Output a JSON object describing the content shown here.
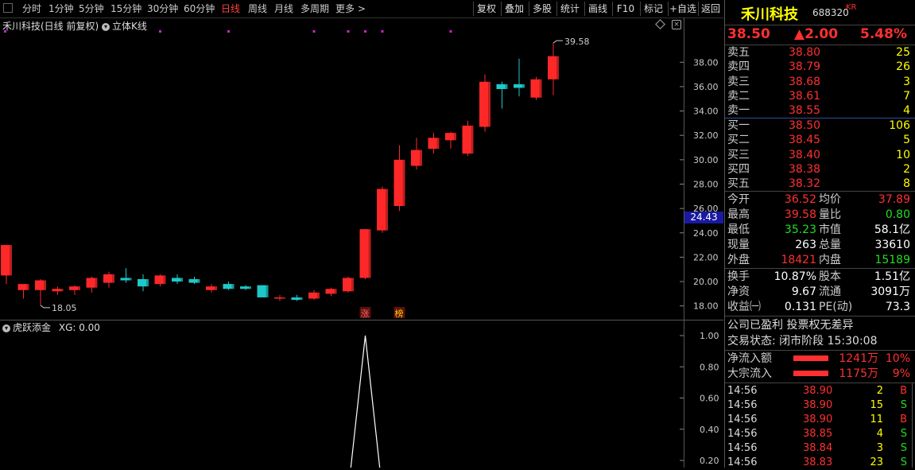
{
  "toolbar": {
    "periods": [
      "分时",
      "1分钟",
      "5分钟",
      "15分钟",
      "30分钟",
      "60分钟",
      "日线",
      "周线",
      "月线",
      "多周期",
      "更多 >"
    ],
    "active_period": "日线",
    "buttons": [
      "复权",
      "叠加",
      "多股",
      "统计",
      "画线",
      "F10",
      "标记",
      "+自选",
      "返回"
    ]
  },
  "chart": {
    "title": "禾川科技(日线 前复权)",
    "mode_label": "立体K线",
    "max_label": "39.58",
    "min_label": "18.05",
    "current_price_tag": "24.43",
    "y_ticks": [
      "38.00",
      "36.00",
      "34.00",
      "32.00",
      "30.00",
      "28.00",
      "26.00",
      "24.00",
      "22.00",
      "20.00",
      "18.00"
    ],
    "markers": [
      "涨",
      "榜"
    ],
    "indicator_title": "虎跃添金",
    "indicator_value": "XG: 0.00",
    "indicator_ticks": [
      "1.00",
      "0.80",
      "0.60",
      "0.40",
      "0.20"
    ]
  },
  "chart_data": {
    "type": "candlestick",
    "ylim": [
      17.0,
      40.5
    ],
    "candles": [
      {
        "o": 20.5,
        "h": 23.0,
        "l": 19.8,
        "c": 23.0
      },
      {
        "o": 19.3,
        "h": 19.7,
        "l": 18.6,
        "c": 19.8
      },
      {
        "o": 19.3,
        "h": 20.2,
        "l": 18.05,
        "c": 20.1
      },
      {
        "o": 19.2,
        "h": 19.6,
        "l": 18.9,
        "c": 19.4
      },
      {
        "o": 19.3,
        "h": 19.7,
        "l": 18.9,
        "c": 19.6
      },
      {
        "o": 19.5,
        "h": 20.4,
        "l": 19.1,
        "c": 20.3
      },
      {
        "o": 19.9,
        "h": 20.8,
        "l": 19.5,
        "c": 20.6
      },
      {
        "o": 20.3,
        "h": 21.1,
        "l": 19.9,
        "c": 20.1
      },
      {
        "o": 20.2,
        "h": 20.6,
        "l": 19.2,
        "c": 19.6
      },
      {
        "o": 19.8,
        "h": 20.6,
        "l": 19.6,
        "c": 20.5
      },
      {
        "o": 20.3,
        "h": 20.6,
        "l": 19.8,
        "c": 20.0
      },
      {
        "o": 20.2,
        "h": 20.4,
        "l": 19.8,
        "c": 19.9
      },
      {
        "o": 19.3,
        "h": 19.8,
        "l": 19.1,
        "c": 19.6
      },
      {
        "o": 19.8,
        "h": 20.0,
        "l": 19.3,
        "c": 19.4
      },
      {
        "o": 19.6,
        "h": 19.7,
        "l": 19.3,
        "c": 19.4
      },
      {
        "o": 19.7,
        "h": 19.7,
        "l": 18.7,
        "c": 18.7
      },
      {
        "o": 18.6,
        "h": 18.9,
        "l": 18.4,
        "c": 18.7
      },
      {
        "o": 18.7,
        "h": 18.9,
        "l": 18.4,
        "c": 18.5
      },
      {
        "o": 18.6,
        "h": 19.3,
        "l": 18.5,
        "c": 19.1
      },
      {
        "o": 19.0,
        "h": 19.5,
        "l": 18.8,
        "c": 19.4
      },
      {
        "o": 19.2,
        "h": 20.4,
        "l": 19.1,
        "c": 20.3
      },
      {
        "o": 20.3,
        "h": 24.3,
        "l": 20.2,
        "c": 24.3
      },
      {
        "o": 24.2,
        "h": 27.8,
        "l": 24.0,
        "c": 27.6
      },
      {
        "o": 26.2,
        "h": 31.2,
        "l": 25.8,
        "c": 30.0
      },
      {
        "o": 29.5,
        "h": 31.8,
        "l": 29.2,
        "c": 30.8
      },
      {
        "o": 30.9,
        "h": 32.2,
        "l": 30.5,
        "c": 31.8
      },
      {
        "o": 31.6,
        "h": 32.3,
        "l": 30.9,
        "c": 32.2
      },
      {
        "o": 30.5,
        "h": 33.2,
        "l": 30.3,
        "c": 32.8
      },
      {
        "o": 32.7,
        "h": 37.0,
        "l": 32.3,
        "c": 36.4
      },
      {
        "o": 36.2,
        "h": 36.4,
        "l": 34.2,
        "c": 35.8
      },
      {
        "o": 36.2,
        "h": 38.3,
        "l": 35.2,
        "c": 35.9
      },
      {
        "o": 35.1,
        "h": 36.8,
        "l": 34.9,
        "c": 36.6
      },
      {
        "o": 36.6,
        "h": 39.58,
        "l": 35.3,
        "c": 38.5
      }
    ],
    "indicator_series": [
      0,
      0,
      0,
      0,
      0,
      0,
      0,
      0,
      0,
      0,
      0,
      0,
      0,
      0,
      0,
      0,
      0,
      0,
      0,
      0,
      0,
      1,
      0,
      0,
      0,
      0,
      0,
      0,
      0,
      0,
      0,
      0,
      0
    ],
    "marker_positions": [
      21,
      23
    ]
  },
  "quote": {
    "name": "禾川科技",
    "code": "688320",
    "tag": "KR",
    "price": "38.50",
    "change": "▲2.00",
    "change_pct": "5.48%",
    "asks": [
      {
        "label": "卖五",
        "price": "38.80",
        "vol": "25"
      },
      {
        "label": "卖四",
        "price": "38.79",
        "vol": "26"
      },
      {
        "label": "卖三",
        "price": "38.68",
        "vol": "3"
      },
      {
        "label": "卖二",
        "price": "38.61",
        "vol": "7"
      },
      {
        "label": "卖一",
        "price": "38.55",
        "vol": "4"
      }
    ],
    "bids": [
      {
        "label": "买一",
        "price": "38.50",
        "vol": "106"
      },
      {
        "label": "买二",
        "price": "38.45",
        "vol": "5"
      },
      {
        "label": "买三",
        "price": "38.40",
        "vol": "10"
      },
      {
        "label": "买四",
        "price": "38.38",
        "vol": "2"
      },
      {
        "label": "买五",
        "price": "38.32",
        "vol": "8"
      }
    ],
    "stats": [
      {
        "l1": "今开",
        "v1": "36.52",
        "c1": "red",
        "l2": "均价",
        "v2": "37.89",
        "c2": "red"
      },
      {
        "l1": "最高",
        "v1": "39.58",
        "c1": "red",
        "l2": "量比",
        "v2": "0.80",
        "c2": "green"
      },
      {
        "l1": "最低",
        "v1": "35.23",
        "c1": "green",
        "l2": "市值",
        "v2": "58.1亿",
        "c2": "white"
      },
      {
        "l1": "现量",
        "v1": "263",
        "c1": "white",
        "l2": "总量",
        "v2": "33610",
        "c2": "white"
      },
      {
        "l1": "外盘",
        "v1": "18421",
        "c1": "red",
        "l2": "内盘",
        "v2": "15189",
        "c2": "green"
      }
    ],
    "stats2": [
      {
        "l1": "换手",
        "v1": "10.87%",
        "l2": "股本",
        "v2": "1.51亿"
      },
      {
        "l1": "净资",
        "v1": "9.67",
        "l2": "流通",
        "v2": "3091万"
      },
      {
        "l1": "收益㈠",
        "v1": "0.131",
        "l2": "PE(动)",
        "v2": "73.3"
      }
    ],
    "profit_status": "公司已盈利 投票权无差异",
    "trade_status": "交易状态: 闭市阶段 15:30:08",
    "flows": [
      {
        "label": "净流入额",
        "amount": "1241万",
        "pct": "10%"
      },
      {
        "label": "大宗流入",
        "amount": "1175万",
        "pct": "9%"
      }
    ],
    "ticks": [
      {
        "time": "14:56",
        "price": "38.90",
        "vol": "2",
        "side": "B"
      },
      {
        "time": "14:56",
        "price": "38.90",
        "vol": "15",
        "side": "S"
      },
      {
        "time": "14:56",
        "price": "38.90",
        "vol": "11",
        "side": "B"
      },
      {
        "time": "14:56",
        "price": "38.85",
        "vol": "4",
        "side": "S"
      },
      {
        "time": "14:56",
        "price": "38.84",
        "vol": "3",
        "side": "S"
      },
      {
        "time": "14:56",
        "price": "38.83",
        "vol": "23",
        "side": "S"
      }
    ]
  }
}
